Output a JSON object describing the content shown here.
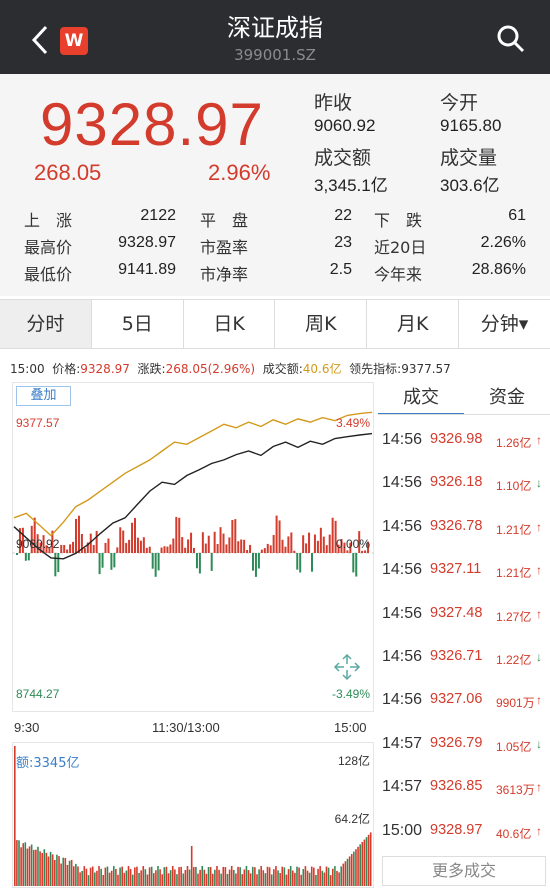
{
  "header": {
    "title": "深证成指",
    "code": "399001.SZ",
    "logo_letter": "W",
    "back_icon": "chevron-left-icon",
    "search_icon": "search-icon"
  },
  "quote": {
    "price": "9328.97",
    "change": "268.05",
    "change_pct": "2.96%",
    "prev_close_label": "昨收",
    "prev_close": "9060.92",
    "open_label": "今开",
    "open": "9165.80",
    "turnover_label": "成交额",
    "turnover": "3,345.1亿",
    "volume_label": "成交量",
    "volume": "303.6亿"
  },
  "stats": [
    {
      "label": "上　涨",
      "value": "2122",
      "label2": "平　盘",
      "value2": "22",
      "label3": "下　跌",
      "value3": "61"
    },
    {
      "label": "最高价",
      "value": "9328.97",
      "label2": "市盈率",
      "value2": "23",
      "label3": "近20日",
      "value3": "2.26%"
    },
    {
      "label": "最低价",
      "value": "9141.89",
      "label2": "市净率",
      "value2": "2.5",
      "label3": "今年来",
      "value3": "28.86%"
    }
  ],
  "tabs": [
    "分时",
    "5日",
    "日K",
    "周K",
    "月K",
    "分钟▾"
  ],
  "info_bar": {
    "time": "15:00",
    "price_label": "价格:",
    "price": "9328.97",
    "chg_label": "涨跌:",
    "chg": "268.05(2.96%)",
    "amt_label": "成交额:",
    "amt": "40.6亿",
    "lead_label": "领先指标:",
    "lead": "9377.57"
  },
  "chart": {
    "overlay_label": "叠加",
    "y_top": "9377.57",
    "y_mid": "9060.92",
    "y_bottom": "8744.27",
    "pct_top": "3.49%",
    "pct_mid": "0.00%",
    "pct_bottom": "-3.49%",
    "times": [
      "9:30",
      "11:30/13:00",
      "15:00"
    ],
    "vol_label": "额:3345亿",
    "vol_top": "128亿",
    "vol_mid": "64.2亿",
    "expand_icon": "expand-arrows-icon"
  },
  "chart_data": {
    "type": "line",
    "ylim": [
      8744.27,
      9377.57
    ],
    "prev_close": 9060.92,
    "series": [
      {
        "color": "#222222",
        "values": [
          9120,
          9095,
          9070,
          9050,
          9048,
          9060,
          9080,
          9105,
          9128,
          9140,
          9170,
          9200,
          9220,
          9215,
          9235,
          9248,
          9262,
          9270,
          9282,
          9290,
          9280,
          9300,
          9310,
          9298,
          9312,
          9305,
          9318,
          9322,
          9326,
          9329
        ]
      },
      {
        "color": "#d49a1c",
        "values": [
          9140,
          9150,
          9125,
          9100,
          9130,
          9165,
          9180,
          9200,
          9220,
          9240,
          9255,
          9270,
          9290,
          9310,
          9305,
          9320,
          9335,
          9350,
          9342,
          9355,
          9345,
          9360,
          9350,
          9362,
          9355,
          9365,
          9358,
          9370,
          9374,
          9377
        ]
      }
    ]
  },
  "trades_tabs": [
    "成交",
    "资金"
  ],
  "trades": [
    {
      "time": "14:56",
      "price": "9326.98",
      "vol": "1.26亿",
      "dir": "↑",
      "up": true
    },
    {
      "time": "14:56",
      "price": "9326.18",
      "vol": "1.10亿",
      "dir": "↓",
      "up": false
    },
    {
      "time": "14:56",
      "price": "9326.78",
      "vol": "1.21亿",
      "dir": "↑",
      "up": true
    },
    {
      "time": "14:56",
      "price": "9327.11",
      "vol": "1.21亿",
      "dir": "↑",
      "up": true
    },
    {
      "time": "14:56",
      "price": "9327.48",
      "vol": "1.27亿",
      "dir": "↑",
      "up": true
    },
    {
      "time": "14:56",
      "price": "9326.71",
      "vol": "1.22亿",
      "dir": "↓",
      "up": false
    },
    {
      "time": "14:56",
      "price": "9327.06",
      "vol": "9901万",
      "dir": "↑",
      "up": true
    },
    {
      "time": "14:57",
      "price": "9326.79",
      "vol": "1.05亿",
      "dir": "↓",
      "up": false
    },
    {
      "time": "14:57",
      "price": "9326.85",
      "vol": "3613万",
      "dir": "↑",
      "up": true
    },
    {
      "time": "15:00",
      "price": "9328.97",
      "vol": "40.6亿",
      "dir": "↑",
      "up": true
    }
  ],
  "more_button": "更多成交",
  "colors": {
    "up": "#d33b2c",
    "down": "#2e8b57",
    "accent": "#3b7fc9",
    "gold": "#d49a1c"
  }
}
